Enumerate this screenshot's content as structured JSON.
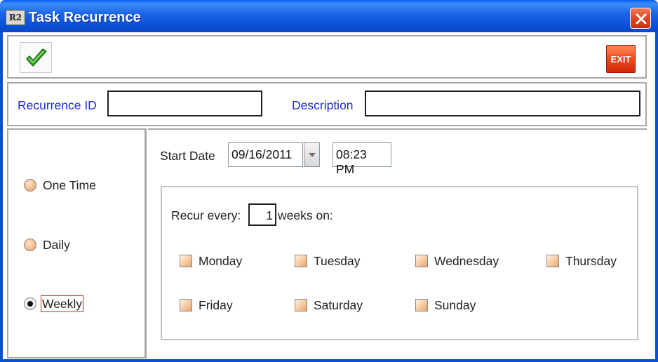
{
  "window": {
    "title": "Task Recurrence",
    "app_icon_text": "R2"
  },
  "toolbar": {
    "ok_icon": "green-checkmark-icon",
    "exit_label": "EXIT"
  },
  "header_fields": {
    "recurrence_id_label": "Recurrence ID",
    "recurrence_id_value": "",
    "description_label": "Description",
    "description_value": ""
  },
  "recurrence_types": [
    {
      "label": "One Time",
      "selected": false
    },
    {
      "label": "Daily",
      "selected": false
    },
    {
      "label": "Weekly",
      "selected": true
    }
  ],
  "schedule": {
    "start_date_label": "Start Date",
    "start_date": "09/16/2011",
    "start_time": "08:23 PM"
  },
  "weekly": {
    "recur_every_label": "Recur every:",
    "recur_every_value": "1",
    "weeks_on_label": "weeks on:",
    "days": [
      {
        "label": "Monday",
        "checked": false
      },
      {
        "label": "Tuesday",
        "checked": false
      },
      {
        "label": "Wednesday",
        "checked": false
      },
      {
        "label": "Thursday",
        "checked": false
      },
      {
        "label": "Friday",
        "checked": false
      },
      {
        "label": "Saturday",
        "checked": false
      },
      {
        "label": "Sunday",
        "checked": false
      }
    ]
  },
  "colors": {
    "titlebar": "#0A50D8",
    "label_blue": "#1F2BD6",
    "exit_red": "#F04A1E"
  }
}
